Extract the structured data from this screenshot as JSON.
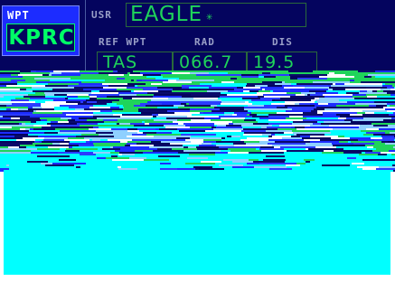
{
  "waypoint": {
    "label": "WPT",
    "identifier": "KPRC"
  },
  "user_waypoint": {
    "label": "USR",
    "name": "EAGLE",
    "marker_icon": "asterisk-icon"
  },
  "columns": {
    "ref_label": "REF WPT",
    "rad_label": "RAD",
    "dis_label": "DIS"
  },
  "values": {
    "ref_waypoint": "TAS",
    "radial": "066.7",
    "distance": "19.5"
  },
  "colors": {
    "background": "#04045e",
    "tab": "#1c2cff",
    "text_green": "#1fd45a",
    "cyan_fill": "#00ffff"
  }
}
